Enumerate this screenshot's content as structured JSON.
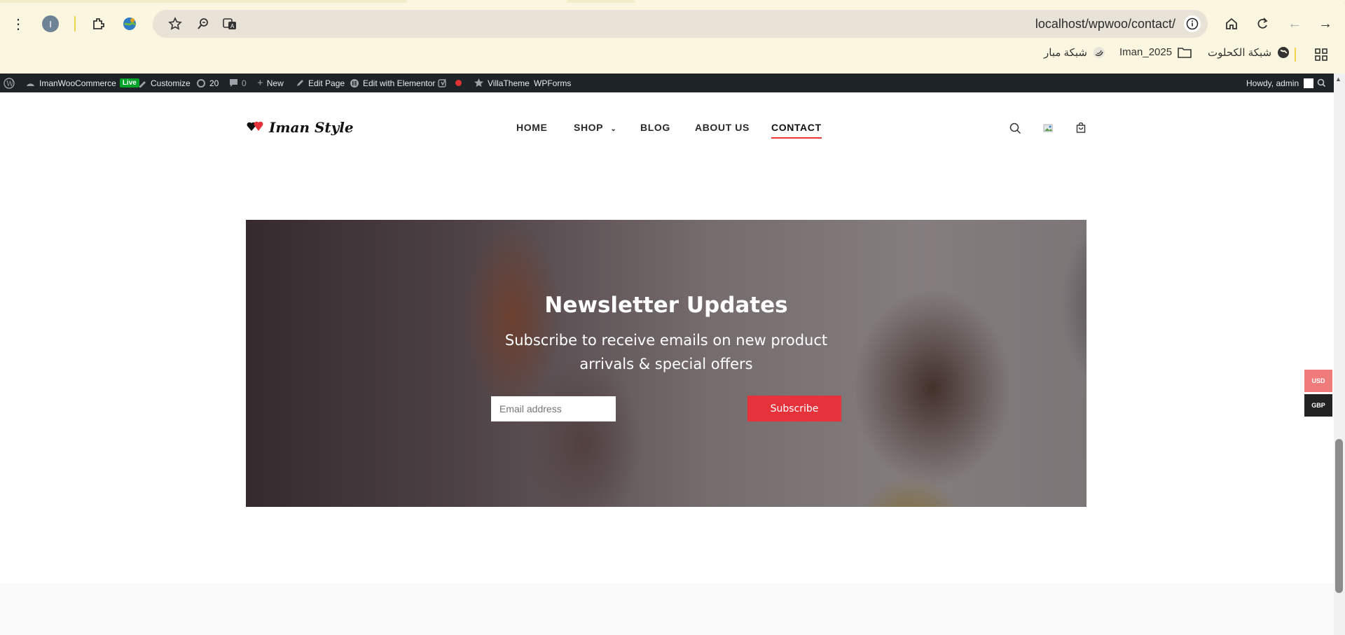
{
  "browser": {
    "url": "localhost/wpwoo/contact/",
    "profile_initial": "I",
    "bookmarks": [
      "شبكة الكحلوت",
      "Iman_2025",
      "شبكة مبار"
    ]
  },
  "admin_bar": {
    "site_name": "ImanWooCommerce",
    "live_badge": "Live",
    "customize": "Customize",
    "updates_count": "20",
    "comments_count": "0",
    "new_label": "New",
    "edit_page": "Edit Page",
    "edit_elementor": "Edit with Elementor",
    "villatheme": "VillaTheme",
    "wpforms": "WPForms",
    "howdy": "Howdy, admin"
  },
  "site": {
    "logo_text": "Iman Style",
    "nav": [
      "HOME",
      "SHOP",
      "BLOG",
      "ABOUT US",
      "CONTACT"
    ],
    "active_nav": "CONTACT"
  },
  "newsletter": {
    "title": "Newsletter Updates",
    "subtitle": "Subscribe to receive emails on new product arrivals & special offers",
    "email_placeholder": "Email address",
    "button_label": "Subscribe"
  },
  "currency": {
    "options": [
      "USD",
      "GBP"
    ],
    "colors": {
      "usd": "#f07b7b",
      "gbp": "#222222"
    }
  },
  "colors": {
    "accent": "#e6333b",
    "admin_bar": "#1d2327",
    "chrome": "#fbf6df"
  }
}
